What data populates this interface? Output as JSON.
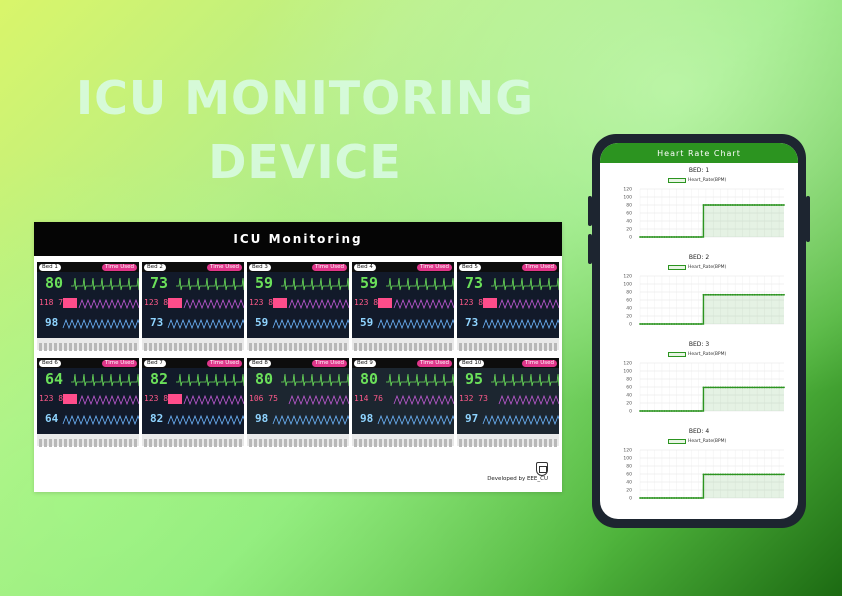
{
  "hero": {
    "line1": "ICU MONITORING",
    "line2": "DEVICE"
  },
  "dashboard": {
    "title": "ICU Monitoring",
    "beds": [
      {
        "bed": "Bed 1",
        "time": "Time Used",
        "hr": "80",
        "bp": "118 79",
        "spo2": "98"
      },
      {
        "bed": "Bed 2",
        "time": "Time Used",
        "hr": "73",
        "bp": "123 89",
        "spo2": "73"
      },
      {
        "bed": "Bed 3",
        "time": "Time Used",
        "hr": "59",
        "bp": "123 89",
        "spo2": "59"
      },
      {
        "bed": "Bed 4",
        "time": "Time Used",
        "hr": "59",
        "bp": "123 89",
        "spo2": "59"
      },
      {
        "bed": "Bed 5",
        "time": "Time Used",
        "hr": "73",
        "bp": "123 89",
        "spo2": "73"
      },
      {
        "bed": "Bed 6",
        "time": "Time Used",
        "hr": "64",
        "bp": "123 89",
        "spo2": "64"
      },
      {
        "bed": "Bed 7",
        "time": "Time Used",
        "hr": "82",
        "bp": "123 89",
        "spo2": "82"
      },
      {
        "bed": "Bed 8",
        "time": "Time Used",
        "hr": "80",
        "bp": "106 75",
        "spo2": "98"
      },
      {
        "bed": "Bed 9",
        "time": "Time Used",
        "hr": "80",
        "bp": "114 76",
        "spo2": "98"
      },
      {
        "bed": "Bed 10",
        "time": "Time Used",
        "hr": "95",
        "bp": "132 73",
        "spo2": "97"
      }
    ],
    "credit": "Developed by EEE_CU",
    "credit_icon": "university-crest-icon"
  },
  "phone": {
    "header": "Heart Rate Chart",
    "charts": [
      {
        "title": "BED: 1",
        "legend": "Heart_Rate(BPM)"
      },
      {
        "title": "BED: 2",
        "legend": "Heart_Rate(BPM)"
      },
      {
        "title": "BED: 3",
        "legend": "Heart_Rate(BPM)"
      },
      {
        "title": "BED: 4",
        "legend": "Heart_Rate(BPM)"
      }
    ]
  },
  "chart_data": [
    {
      "type": "line",
      "title": "BED: 1",
      "series": [
        {
          "name": "Heart_Rate(BPM)",
          "values": [
            0,
            0,
            0,
            0,
            0,
            0,
            0,
            0,
            0,
            0,
            0,
            0,
            0,
            0,
            0,
            0,
            0,
            0,
            0,
            0,
            0,
            0,
            0,
            0,
            0,
            0,
            80,
            80,
            80,
            80,
            80,
            80,
            80,
            80,
            80,
            80,
            80,
            80,
            80,
            80,
            80,
            80,
            80,
            80,
            80,
            80,
            80,
            80,
            80,
            80,
            80,
            80,
            80,
            80,
            80,
            80,
            80,
            80,
            80,
            80
          ]
        }
      ],
      "ylim": [
        0,
        120
      ],
      "yticks": [
        "120",
        "100",
        "80",
        "60",
        "40",
        "20",
        "0"
      ],
      "color": "#2c9420"
    },
    {
      "title": "BED: 2",
      "type": "line",
      "series": [
        {
          "name": "Heart_Rate(BPM)",
          "values": [
            0,
            0,
            0,
            0,
            0,
            0,
            0,
            0,
            0,
            0,
            0,
            0,
            0,
            0,
            0,
            0,
            0,
            0,
            0,
            0,
            0,
            0,
            0,
            0,
            0,
            0,
            73,
            73,
            73,
            73,
            73,
            73,
            73,
            73,
            73,
            73,
            73,
            73,
            73,
            73,
            73,
            73,
            73,
            73,
            73,
            73,
            73,
            73,
            73,
            73,
            73,
            73,
            73,
            73,
            73,
            73,
            73,
            73,
            73,
            73
          ]
        }
      ],
      "ylim": [
        0,
        120
      ],
      "yticks": [
        "120",
        "100",
        "80",
        "60",
        "40",
        "20",
        "0"
      ],
      "color": "#2c9420"
    },
    {
      "title": "BED: 3",
      "type": "line",
      "series": [
        {
          "name": "Heart_Rate(BPM)",
          "values": [
            0,
            0,
            0,
            0,
            0,
            0,
            0,
            0,
            0,
            0,
            0,
            0,
            0,
            0,
            0,
            0,
            0,
            0,
            0,
            0,
            0,
            0,
            0,
            0,
            0,
            0,
            59,
            59,
            59,
            59,
            59,
            59,
            59,
            59,
            59,
            59,
            59,
            59,
            59,
            59,
            59,
            59,
            59,
            59,
            59,
            59,
            59,
            59,
            59,
            59,
            59,
            59,
            59,
            59,
            59,
            59,
            59,
            59,
            59,
            59
          ]
        }
      ],
      "ylim": [
        0,
        120
      ],
      "yticks": [
        "120",
        "100",
        "80",
        "60",
        "40",
        "20",
        "0"
      ],
      "color": "#2c9420"
    },
    {
      "title": "BED: 4",
      "type": "line",
      "series": [
        {
          "name": "Heart_Rate(BPM)",
          "values": [
            0,
            0,
            0,
            0,
            0,
            0,
            0,
            0,
            0,
            0,
            0,
            0,
            0,
            0,
            0,
            0,
            0,
            0,
            0,
            0,
            0,
            0,
            0,
            0,
            0,
            0,
            59,
            59,
            59,
            59,
            59,
            59,
            59,
            59,
            59,
            59,
            59,
            59,
            59,
            59,
            59,
            59,
            59,
            59,
            59,
            59,
            59,
            59,
            59,
            59,
            59,
            59,
            59,
            59,
            59,
            59,
            59,
            59,
            59,
            59
          ]
        }
      ],
      "ylim": [
        0,
        120
      ],
      "yticks": [
        "120",
        "100",
        "80",
        "60",
        "40",
        "20",
        "0"
      ],
      "color": "#2c9420"
    }
  ]
}
